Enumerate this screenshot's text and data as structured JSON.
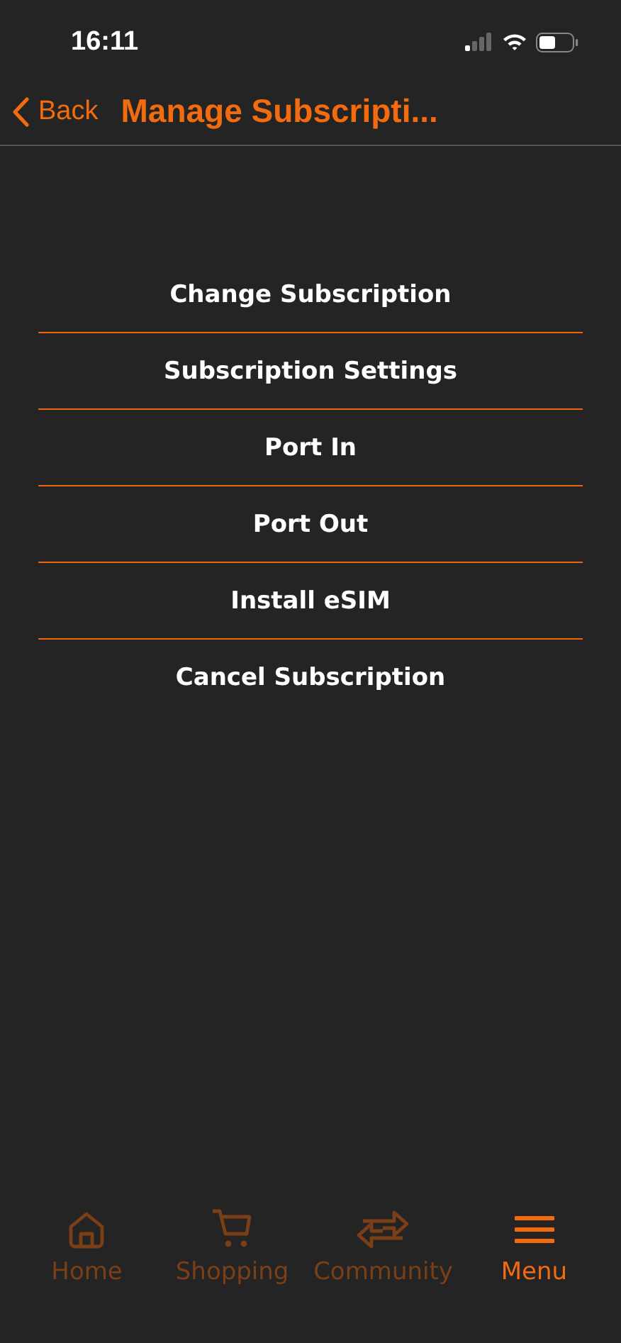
{
  "status_bar": {
    "time": "16:11"
  },
  "nav": {
    "back": "Back",
    "title": "Manage Subscripti..."
  },
  "menu_items": [
    "Change Subscription",
    "Subscription Settings",
    "Port In",
    "Port Out",
    "Install eSIM",
    "Cancel Subscription"
  ],
  "tabs": [
    {
      "label": "Home",
      "kind": "home",
      "selected": false
    },
    {
      "label": "Shopping",
      "kind": "cart",
      "selected": false
    },
    {
      "label": "Community",
      "kind": "swap",
      "selected": false
    },
    {
      "label": "Menu",
      "kind": "menu",
      "selected": true
    }
  ]
}
